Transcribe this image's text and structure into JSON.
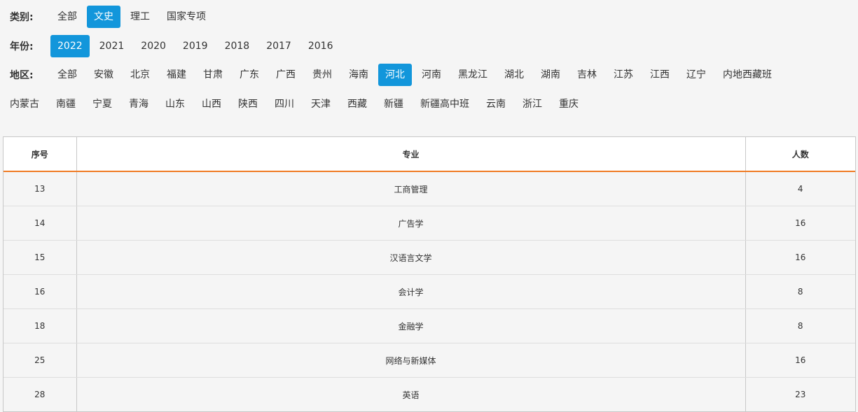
{
  "filters": {
    "category": {
      "label": "类别:",
      "options": [
        "全部",
        "文史",
        "理工",
        "国家专项"
      ],
      "selected": "文史"
    },
    "year": {
      "label": "年份:",
      "options": [
        "2022",
        "2021",
        "2020",
        "2019",
        "2018",
        "2017",
        "2016"
      ],
      "selected": "2022"
    },
    "region": {
      "label": "地区:",
      "options": [
        "全部",
        "安徽",
        "北京",
        "福建",
        "甘肃",
        "广东",
        "广西",
        "贵州",
        "海南",
        "河北",
        "河南",
        "黑龙江",
        "湖北",
        "湖南",
        "吉林",
        "江苏",
        "江西",
        "辽宁",
        "内地西藏班",
        "内蒙古",
        "南疆",
        "宁夏",
        "青海",
        "山东",
        "山西",
        "陕西",
        "四川",
        "天津",
        "西藏",
        "新疆",
        "新疆高中班",
        "云南",
        "浙江",
        "重庆"
      ],
      "selected": "河北"
    }
  },
  "table": {
    "headers": [
      "序号",
      "专业",
      "人数"
    ],
    "rows": [
      [
        "13",
        "工商管理",
        "4"
      ],
      [
        "14",
        "广告学",
        "16"
      ],
      [
        "15",
        "汉语言文学",
        "16"
      ],
      [
        "16",
        "会计学",
        "8"
      ],
      [
        "18",
        "金融学",
        "8"
      ],
      [
        "25",
        "网络与新媒体",
        "16"
      ],
      [
        "28",
        "英语",
        "23"
      ]
    ]
  },
  "colors": {
    "accent": "#1296db",
    "header_underline": "#f07a22"
  }
}
